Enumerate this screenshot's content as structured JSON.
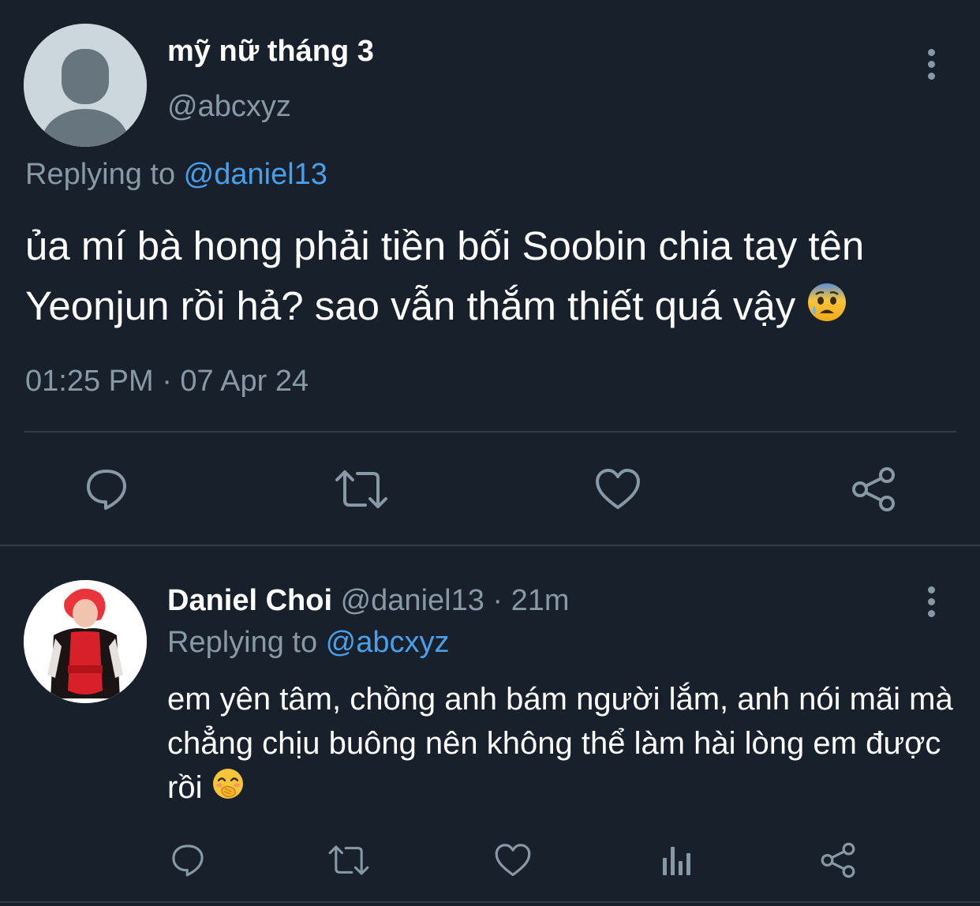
{
  "main_tweet": {
    "display_name": "mỹ nữ tháng 3",
    "handle": "@abcxyz",
    "replying_prefix": "Replying to ",
    "replying_to": "@daniel13",
    "text": "ủa mí bà hong phải tiền bối Soobin chia tay tên Yeonjun rồi hả? sao vẫn thắm thiết quá vậy",
    "emoji": "anxious-face-with-sweat",
    "timestamp": "01:25 PM · 07 Apr 24",
    "actions": [
      "reply-icon",
      "retweet-icon",
      "like-icon",
      "share-icon"
    ]
  },
  "reply_tweet": {
    "display_name": "Daniel Choi",
    "handle_and_time": "@daniel13 · 21m",
    "replying_prefix": "Replying to ",
    "replying_to": "@abcxyz",
    "text": "em yên tâm, chồng anh bám người lắm, anh nói mãi mà chẳng chịu buông nên không thể làm hài lòng em được rồi",
    "emoji": "face-with-hand-over-mouth",
    "actions": [
      "reply-icon",
      "retweet-icon",
      "like-icon",
      "analytics-icon",
      "share-icon"
    ]
  },
  "colors": {
    "background": "#17202b",
    "secondary_text": "#8899a6",
    "mention": "#4a9fe8",
    "divider": "#2f3b47"
  }
}
